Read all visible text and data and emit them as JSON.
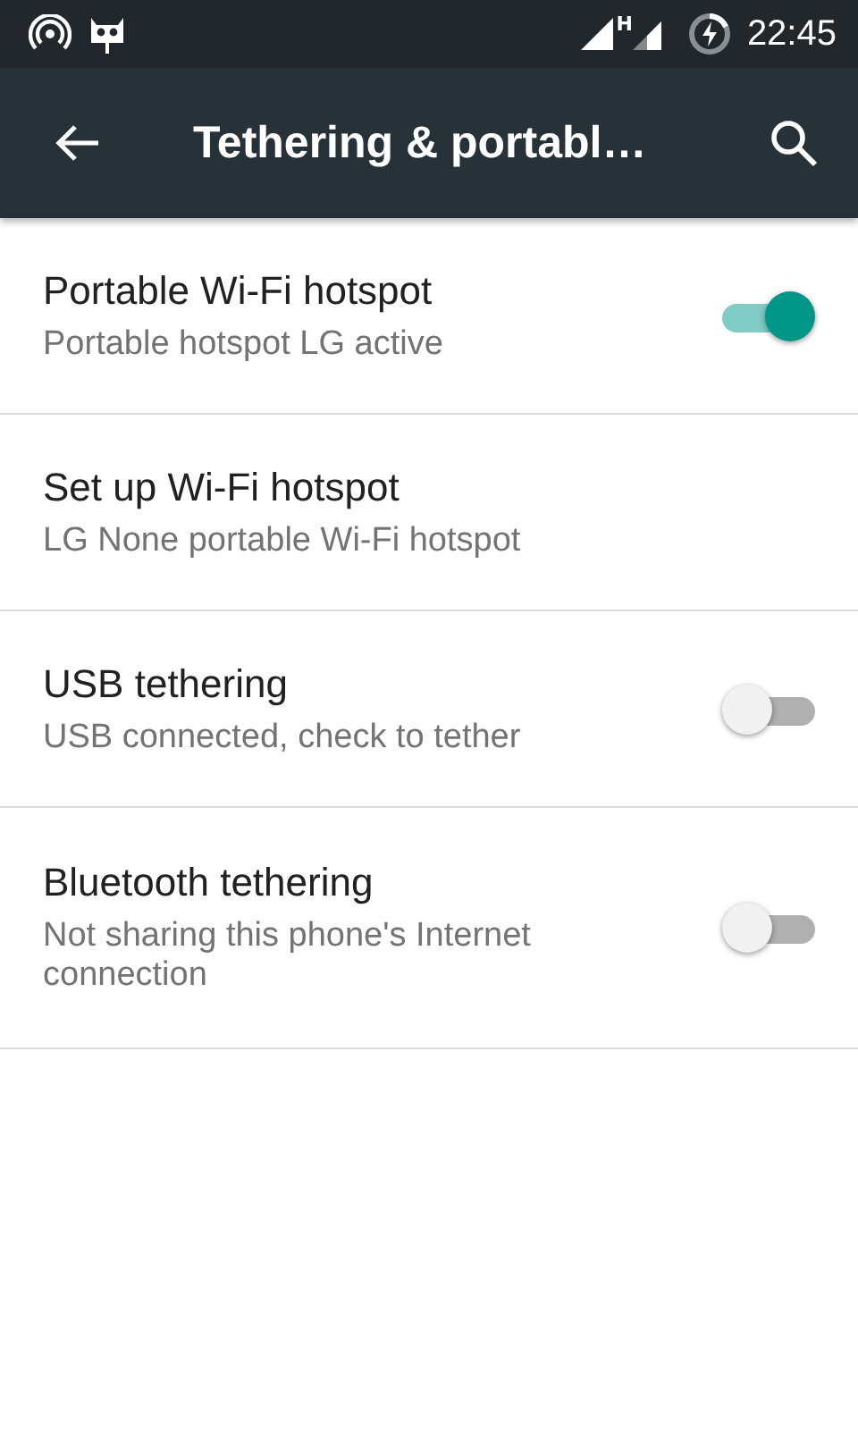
{
  "status_bar": {
    "time": "22:45",
    "network_label": "H"
  },
  "toolbar": {
    "title": "Tethering & portabl…"
  },
  "settings": [
    {
      "kind": "switch",
      "title": "Portable Wi-Fi hotspot",
      "summary": "Portable hotspot LG active",
      "on": true
    },
    {
      "kind": "plain",
      "title": "Set up Wi-Fi hotspot",
      "summary": "LG None portable Wi-Fi hotspot"
    },
    {
      "kind": "switch",
      "title": "USB tethering",
      "summary": "USB connected, check to tether",
      "on": false
    },
    {
      "kind": "switch",
      "title": "Bluetooth tethering",
      "summary": "Not sharing this phone's Internet connection",
      "on": false
    }
  ]
}
